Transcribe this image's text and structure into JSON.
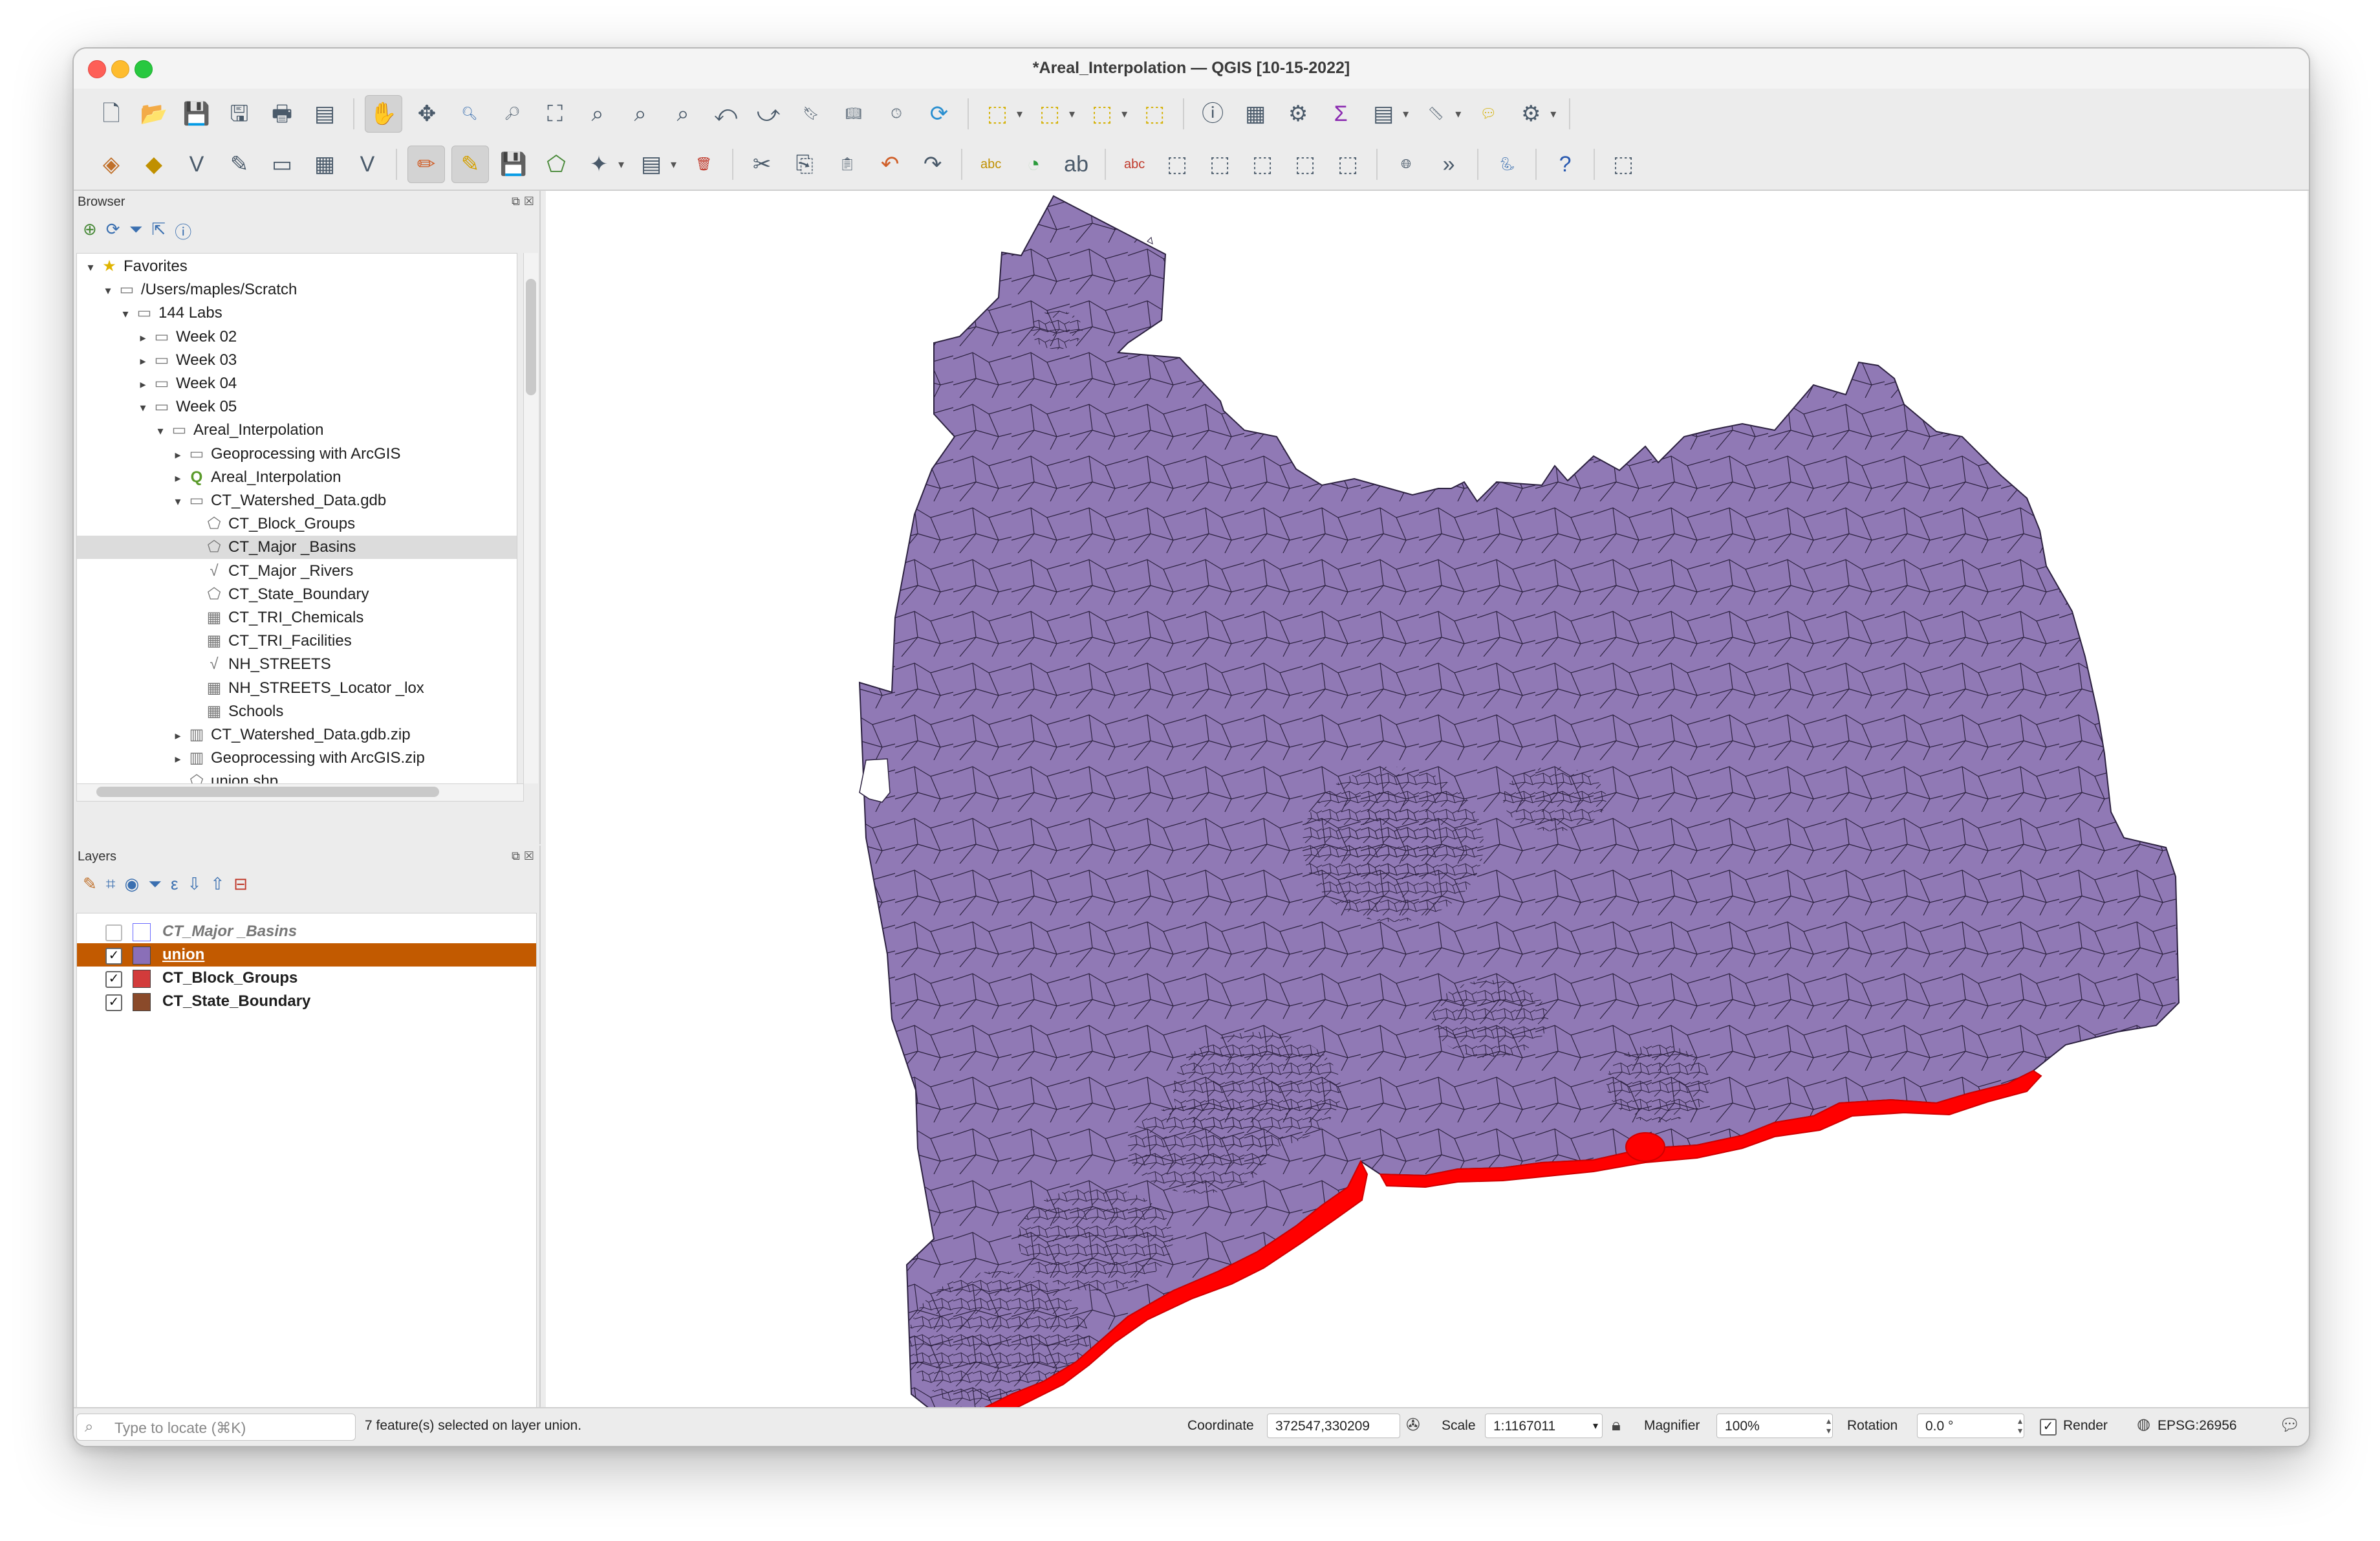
{
  "window": {
    "title": "*Areal_Interpolation — QGIS [10-15-2022]"
  },
  "toolbar1": {
    "icons": [
      "new-project",
      "open-project",
      "save-project",
      "save-as",
      "print-layout",
      "layout-manager",
      "pan",
      "pan-to-selection",
      "zoom-in",
      "zoom-out",
      "zoom-full",
      "zoom-selection",
      "zoom-layer",
      "zoom-native",
      "zoom-last",
      "zoom-next",
      "new-bookmark",
      "show-bookmarks",
      "temporal-controller",
      "refresh",
      "select-features",
      "select-by-value",
      "deselect",
      "select-location",
      "identify",
      "attribute-table",
      "processing-toolbox",
      "statistical-summary",
      "open-table",
      "measure",
      "map-tips",
      "show-layout"
    ]
  },
  "toolbar2": {
    "icons": [
      "data-source-manager",
      "new-geopackage",
      "new-shapefile",
      "digitize",
      "new-temp-layer",
      "new-virtual-layer",
      "new-vector-tile",
      "current-edits",
      "toggle-editing",
      "save-edits",
      "add-polygon",
      "vertex-tool",
      "modify-attributes",
      "delete-selected",
      "cut-features",
      "copy-features",
      "paste-features",
      "undo",
      "redo",
      "label-tool",
      "diagram-tool",
      "pin-labels",
      "show-hide-labels",
      "move-label",
      "rotate-label",
      "change-label",
      "highlight-pinned",
      "annotation-tool",
      "globe",
      "more-tools",
      "python-console",
      "help",
      "plugins"
    ]
  },
  "browser": {
    "title": "Browser",
    "items": [
      {
        "label": "Favorites",
        "indent": 0,
        "arrow": "▾",
        "icon": "★"
      },
      {
        "label": "/Users/maples/Scratch",
        "indent": 1,
        "arrow": "▾",
        "icon": "▭"
      },
      {
        "label": "144 Labs",
        "indent": 2,
        "arrow": "▾",
        "icon": "▭"
      },
      {
        "label": "Week 02",
        "indent": 3,
        "arrow": "▸",
        "icon": "▭"
      },
      {
        "label": "Week 03",
        "indent": 3,
        "arrow": "▸",
        "icon": "▭"
      },
      {
        "label": "Week 04",
        "indent": 3,
        "arrow": "▸",
        "icon": "▭"
      },
      {
        "label": "Week 05",
        "indent": 3,
        "arrow": "▾",
        "icon": "▭"
      },
      {
        "label": "Areal_Interpolation",
        "indent": 4,
        "arrow": "▾",
        "icon": "▭"
      },
      {
        "label": "Geoprocessing with ArcGIS",
        "indent": 5,
        "arrow": "▸",
        "icon": "▭"
      },
      {
        "label": "Areal_Interpolation",
        "indent": 5,
        "arrow": "▸",
        "icon": "Q"
      },
      {
        "label": "CT_Watershed_Data.gdb",
        "indent": 5,
        "arrow": "▾",
        "icon": "▭"
      },
      {
        "label": "CT_Block_Groups",
        "indent": 6,
        "arrow": "",
        "icon": "⬠"
      },
      {
        "label": "CT_Major _Basins",
        "indent": 6,
        "arrow": "",
        "icon": "⬠",
        "selected": true
      },
      {
        "label": "CT_Major _Rivers",
        "indent": 6,
        "arrow": "",
        "icon": "√"
      },
      {
        "label": "CT_State_Boundary",
        "indent": 6,
        "arrow": "",
        "icon": "⬠"
      },
      {
        "label": "CT_TRI_Chemicals",
        "indent": 6,
        "arrow": "",
        "icon": "▦"
      },
      {
        "label": "CT_TRI_Facilities",
        "indent": 6,
        "arrow": "",
        "icon": "▦"
      },
      {
        "label": "NH_STREETS",
        "indent": 6,
        "arrow": "",
        "icon": "√"
      },
      {
        "label": "NH_STREETS_Locator _lox",
        "indent": 6,
        "arrow": "",
        "icon": "▦"
      },
      {
        "label": "Schools",
        "indent": 6,
        "arrow": "",
        "icon": "▦"
      },
      {
        "label": "CT_Watershed_Data.gdb.zip",
        "indent": 5,
        "arrow": "▸",
        "icon": "▥"
      },
      {
        "label": "Geoprocessing with ArcGIS.zip",
        "indent": 5,
        "arrow": "▸",
        "icon": "▥"
      },
      {
        "label": "union.shp",
        "indent": 5,
        "arrow": "",
        "icon": "⬠"
      }
    ]
  },
  "layers": {
    "title": "Layers",
    "items": [
      {
        "name": "CT_Major _Basins",
        "checked": false,
        "swatch": "#ffffff",
        "swatch_border": "#6a6aff",
        "style": "italic"
      },
      {
        "name": "union",
        "checked": true,
        "swatch": "#8a6fb8",
        "style": "selected"
      },
      {
        "name": "CT_Block_Groups",
        "checked": true,
        "swatch": "#d23b3b",
        "style": "bold"
      },
      {
        "name": "CT_State_Boundary",
        "checked": true,
        "swatch": "#8a4a2a",
        "style": "bold"
      }
    ]
  },
  "map": {
    "fill_color": "#9079b5",
    "line_color": "#2c2140",
    "selection_color": "#ff0000"
  },
  "statusbar": {
    "locator_placeholder": "Type to locate (⌘K)",
    "message": "7 feature(s) selected on layer union.",
    "coordinate_label": "Coordinate",
    "coordinate_value": "372547,330209",
    "scale_label": "Scale",
    "scale_value": "1:1167011",
    "magnifier_label": "Magnifier",
    "magnifier_value": "100%",
    "rotation_label": "Rotation",
    "rotation_value": "0.0 °",
    "render_label": "Render",
    "crs": "EPSG:26956"
  }
}
